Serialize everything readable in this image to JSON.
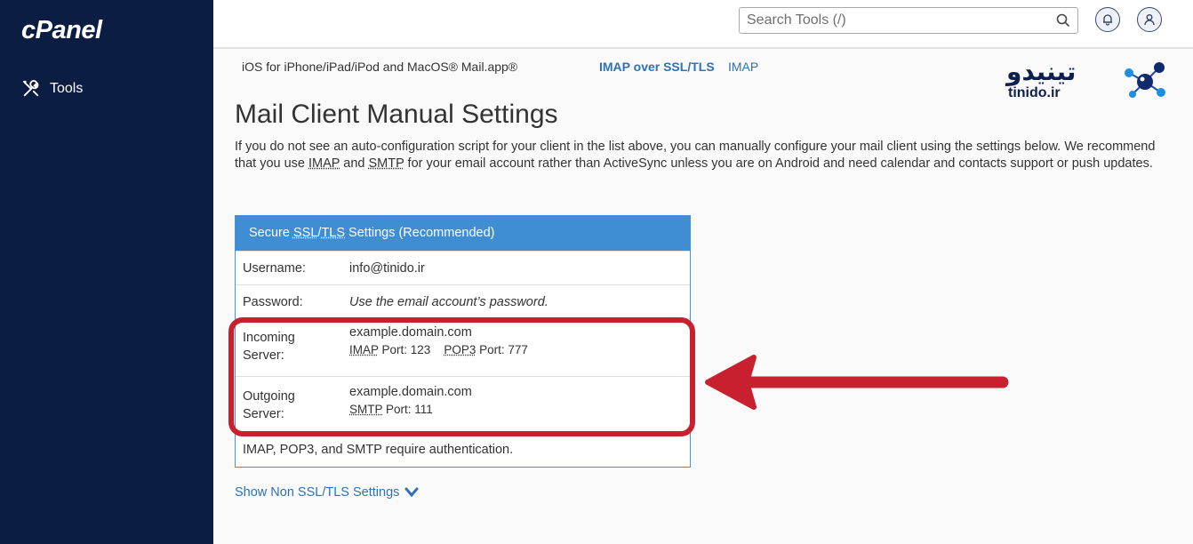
{
  "sidebar": {
    "logo": "cPanel",
    "items": [
      {
        "label": "Tools",
        "icon": "tools-icon"
      }
    ]
  },
  "topbar": {
    "search_placeholder": "Search Tools (/)",
    "icons": [
      "search-icon",
      "bell-icon",
      "user-icon"
    ]
  },
  "client_row": {
    "name": "iOS for iPhone/iPad/iPod and MacOS® Mail.app®",
    "link1": "IMAP over SSL/TLS",
    "link2": "IMAP"
  },
  "main": {
    "title": "Mail Client Manual Settings",
    "intro": {
      "part1": "If you do not see an auto-configuration script for your client in the list above, you can manually configure your mail client using the settings below. We recommend that you use ",
      "imap": "IMAP",
      "and": " and ",
      "smtp": "SMTP",
      "part2": " for your email account rather than ActiveSync unless you are on Android and need calendar and contacts support or push updates."
    }
  },
  "panel": {
    "head": {
      "prefix": "Secure ",
      "ssl": "SSL",
      "slash": "/",
      "tls": "TLS",
      "suffix": " Settings (Recommended)"
    },
    "username_label": "Username:",
    "username_value": "info@tinido.ir",
    "password_label": "Password:",
    "password_value": "Use the email account’s password.",
    "incoming_label_1": "Incoming",
    "incoming_label_2": "Server:",
    "incoming_host": "example.domain.com",
    "imap_abbr": "IMAP",
    "imap_port": " Port: 123",
    "pop3_abbr": "POP3",
    "pop3_port": " Port: 777",
    "outgoing_label_1": "Outgoing",
    "outgoing_label_2": "Server:",
    "outgoing_host": "example.domain.com",
    "smtp_abbr": "SMTP",
    "smtp_port": " Port: 111",
    "auth_note": "IMAP, POP3, and SMTP require authentication."
  },
  "toggle_link": "Show Non SSL/TLS Settings",
  "watermark": {
    "fa": "تینیدو",
    "en": "tinido.ir"
  },
  "colors": {
    "sidebar": "#0b1d43",
    "link": "#2d72b6",
    "panel_head": "#3f8dd3",
    "highlight": "#c8202e"
  }
}
